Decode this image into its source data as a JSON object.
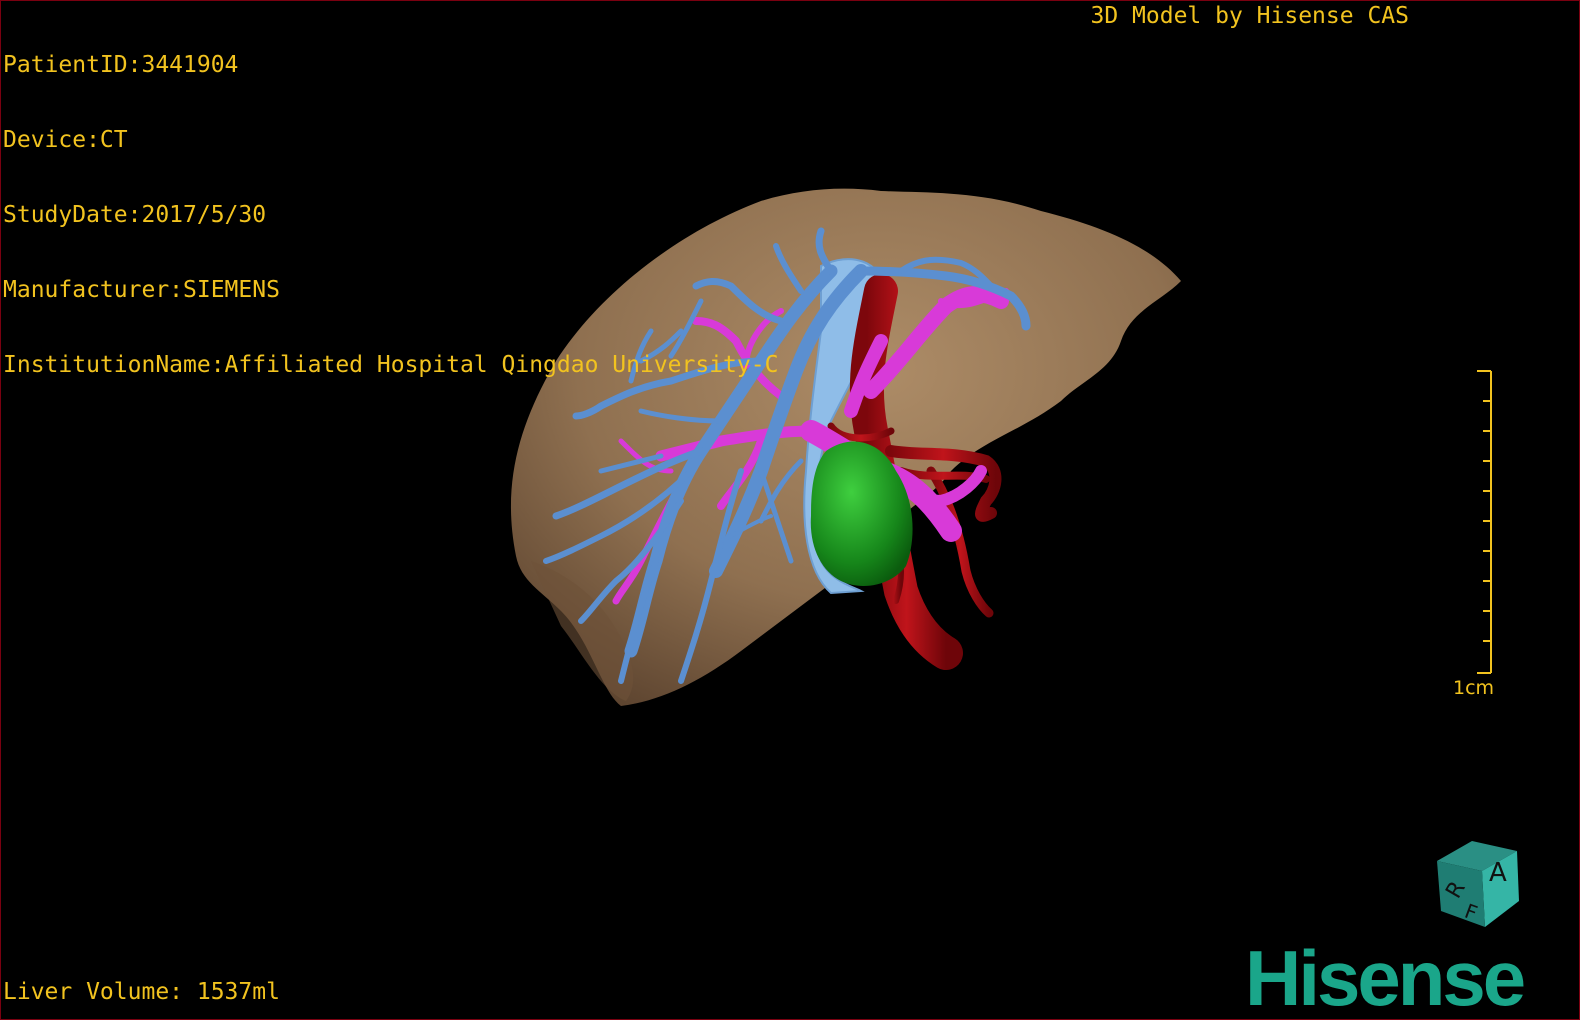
{
  "patient_info": {
    "patient_id": "PatientID:3441904",
    "device": "Device:CT",
    "study_date": "StudyDate:2017/5/30",
    "manufacturer": "Manufacturer:SIEMENS",
    "institution": "InstitutionName:Affiliated Hospital Qingdao University-C"
  },
  "watermark": "3D Model by Hisense CAS",
  "scale": {
    "label": "1cm"
  },
  "footer": {
    "liver_volume": "Liver Volume: 1537ml"
  },
  "orientation_cube": {
    "face_front": "A",
    "face_side": "R",
    "face_bottom": "F"
  },
  "brand": {
    "name": "Hisense"
  },
  "colors": {
    "text": "#f2c31f",
    "liver": "#9b7b58",
    "hepatic_vein": "#5b8fd0",
    "portal_vein": "#d83ad8",
    "artery": "#b0121a",
    "tumor": "#1f9a1f",
    "brand": "#1aa68a"
  }
}
